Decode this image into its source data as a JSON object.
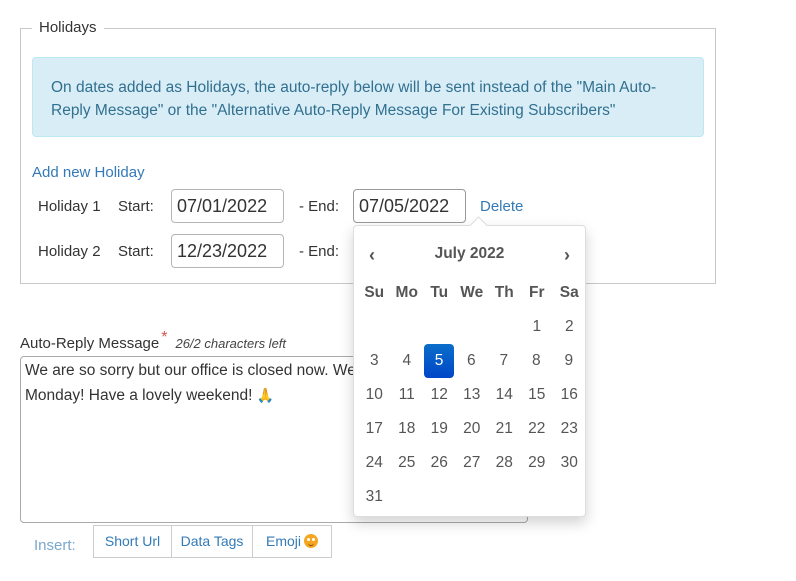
{
  "holidays": {
    "legend": "Holidays",
    "info": "On dates added as Holidays, the auto-reply below will be sent instead of the \"Main Auto-Reply Message\" or the \"Alternative Auto-Reply Message For Existing Subscribers\"",
    "add_link": "Add new Holiday",
    "start_label": "Start:",
    "end_label": "- End:",
    "delete_label": "Delete",
    "items": [
      {
        "name": "Holiday 1",
        "start": "07/01/2022",
        "end": "07/05/2022"
      },
      {
        "name": "Holiday 2",
        "start": "12/23/2022",
        "end": ""
      }
    ]
  },
  "datepicker": {
    "title": "July 2022",
    "prev": "‹",
    "next": "›",
    "weekdays": [
      "Su",
      "Mo",
      "Tu",
      "We",
      "Th",
      "Fr",
      "Sa"
    ],
    "weeks": [
      [
        "",
        "",
        "",
        "",
        "",
        "1",
        "2"
      ],
      [
        "3",
        "4",
        "5",
        "6",
        "7",
        "8",
        "9"
      ],
      [
        "10",
        "11",
        "12",
        "13",
        "14",
        "15",
        "16"
      ],
      [
        "17",
        "18",
        "19",
        "20",
        "21",
        "22",
        "23"
      ],
      [
        "24",
        "25",
        "26",
        "27",
        "28",
        "29",
        "30"
      ],
      [
        "31",
        "",
        "",
        "",
        "",
        "",
        ""
      ]
    ],
    "selected": "5",
    "accent": "#0b6ec9"
  },
  "message": {
    "label": "Auto-Reply Message",
    "required": "*",
    "chars_left": "26/2  characters left",
    "text_line1": "We are so sorry but our office is closed now.  We",
    "text_line2": "Monday!  Have a lovely weekend! ",
    "emoji": "🙏"
  },
  "insert": {
    "label": "Insert:",
    "buttons": [
      "Short Url",
      "Data Tags",
      "Emoji"
    ]
  }
}
